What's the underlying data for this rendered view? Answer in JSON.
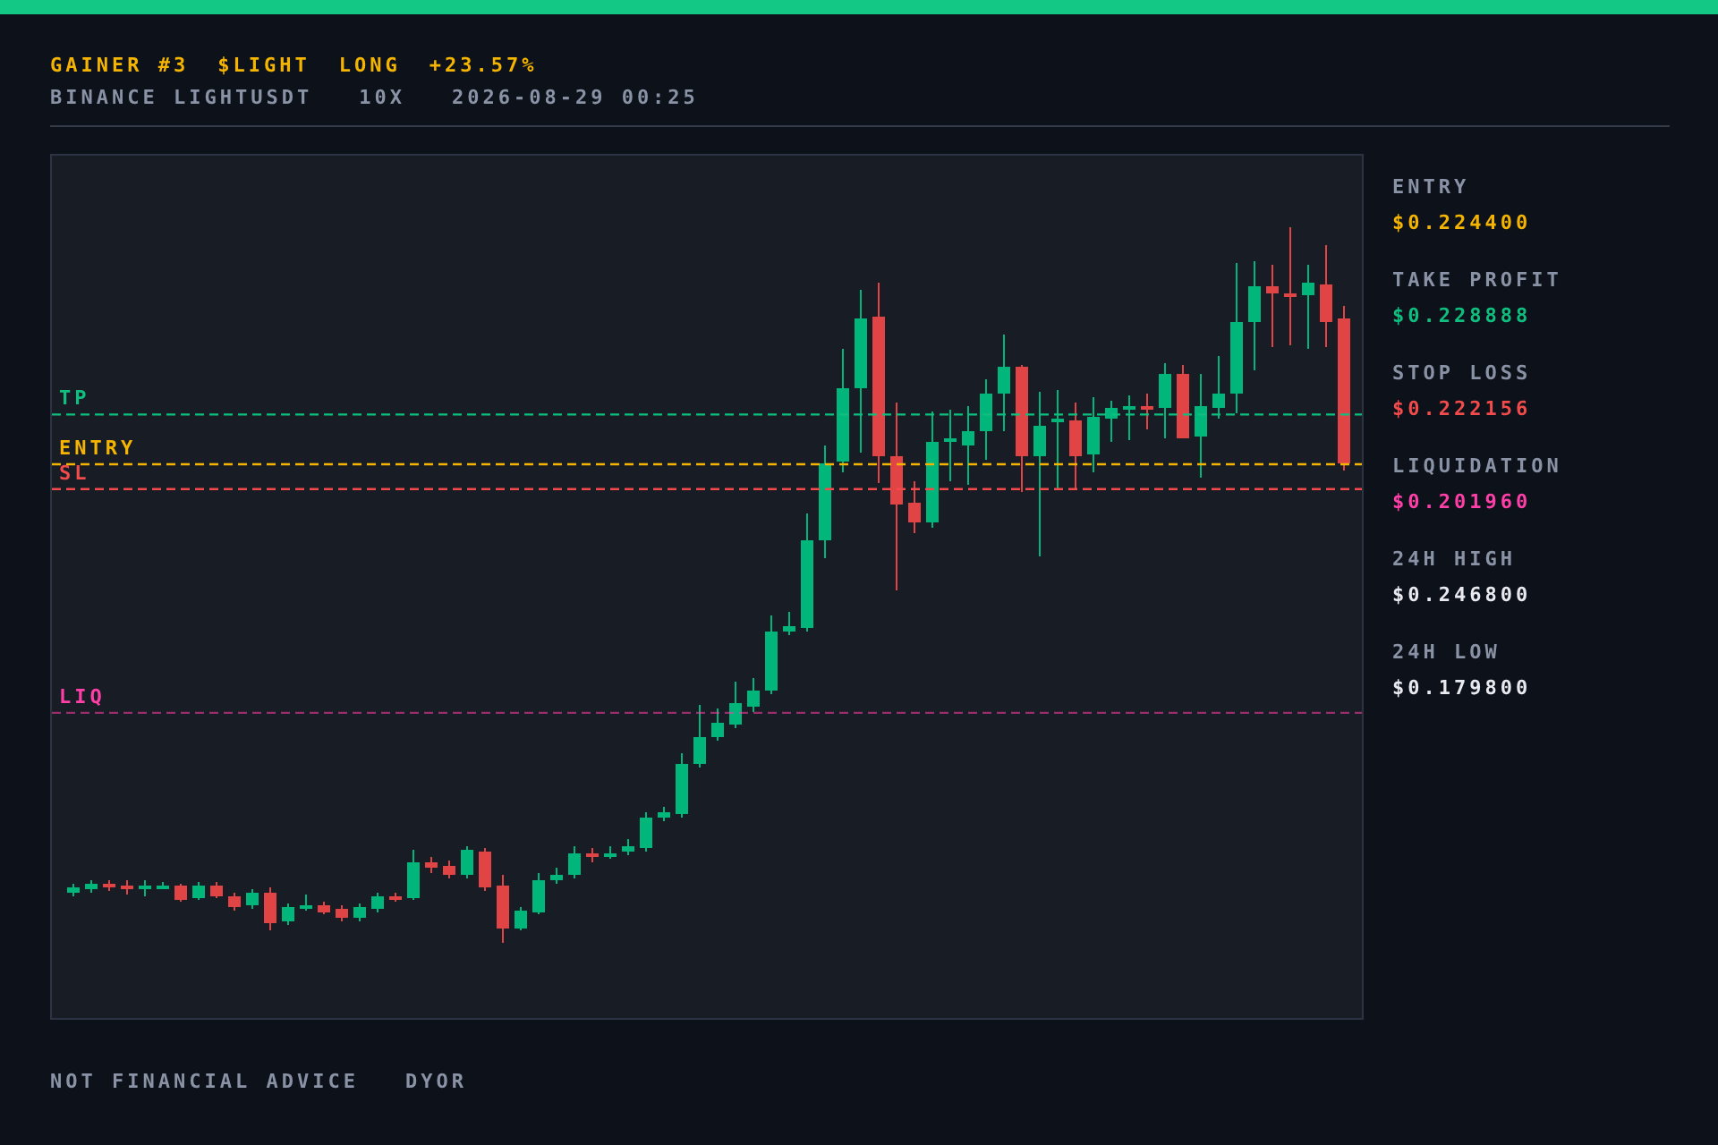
{
  "header": {
    "title_parts": [
      "GAINER #3",
      "$LIGHT",
      "LONG",
      "+23.57%"
    ],
    "subtitle_parts": [
      "BINANCE LIGHTUSDT",
      "10X",
      "2026-08-29 00:25"
    ]
  },
  "stats": [
    {
      "label": "ENTRY",
      "value": "$0.224400",
      "color": "#f5b400",
      "line": {
        "label": "ENTRY"
      }
    },
    {
      "label": "TAKE PROFIT",
      "value": "$0.228888",
      "color": "#0fbf7f",
      "line": {
        "label": "TP"
      }
    },
    {
      "label": "STOP LOSS",
      "value": "$0.222156",
      "color": "#f24b4b",
      "line": {
        "label": "SL"
      }
    },
    {
      "label": "LIQUIDATION",
      "value": "$0.201960",
      "color": "#ff3fa8",
      "line": {
        "label": "LIQ"
      }
    },
    {
      "label": "24H HIGH",
      "value": "$0.246800",
      "color": "#e8eaf0"
    },
    {
      "label": "24H LOW",
      "value": "$0.179800",
      "color": "#e8eaf0"
    }
  ],
  "footer_parts": [
    "NOT FINANCIAL ADVICE",
    "DYOR"
  ]
}
